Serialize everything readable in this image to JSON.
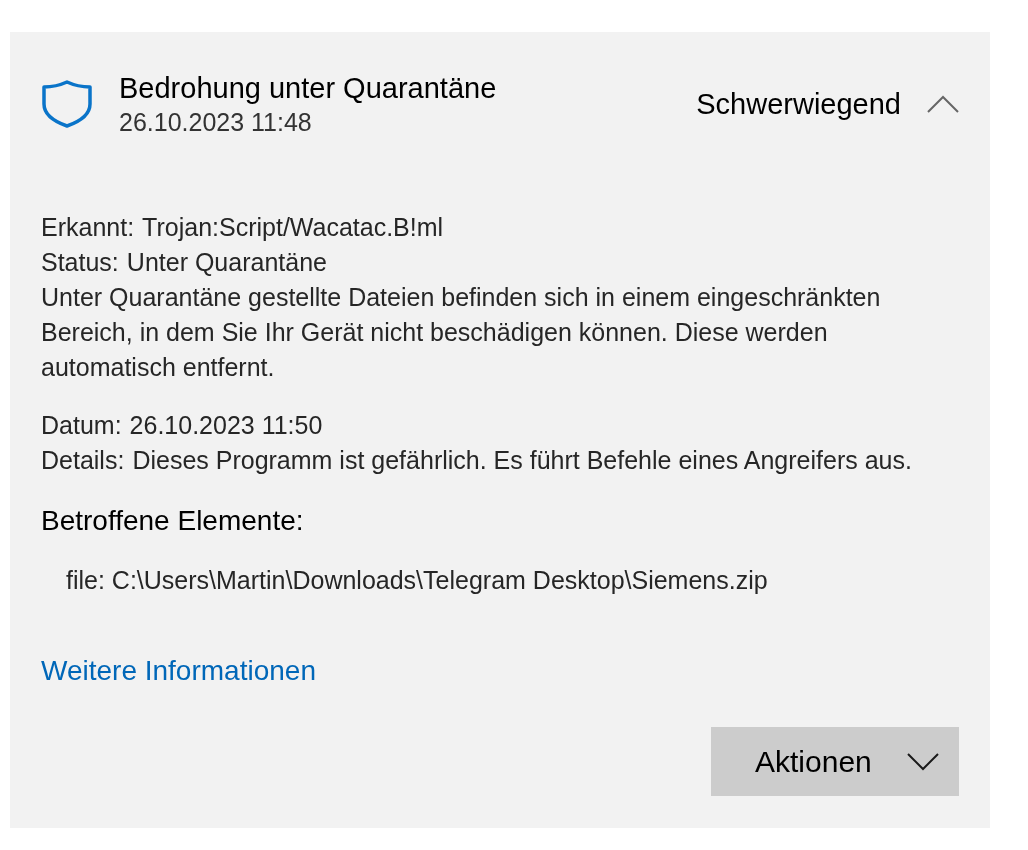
{
  "header": {
    "title": "Bedrohung unter Quarantäne",
    "timestamp": "26.10.2023 11:48",
    "severity": "Schwerwiegend",
    "expanded": true
  },
  "detection": [
    {
      "label": "Erkannt:",
      "value": "Trojan:Script/Wacatac.B!ml"
    },
    {
      "label": "Status:",
      "value": "Unter Quarantäne"
    }
  ],
  "description": "Unter Quarantäne gestellte Dateien befinden sich in einem eingeschränkten Bereich, in dem Sie Ihr Gerät nicht beschädigen können. Diese werden automatisch entfernt.",
  "event": [
    {
      "label": "Datum:",
      "value": "26.10.2023 11:50"
    },
    {
      "label": "Details:",
      "value": "Dieses Programm ist gefährlich. Es führt Befehle eines Angreifers aus."
    }
  ],
  "affected": {
    "heading": "Betroffene Elemente:",
    "items": [
      "file: C:\\Users\\Martin\\Downloads\\Telegram Desktop\\Siemens.zip"
    ]
  },
  "more_info_link": "Weitere Informationen",
  "actions_button": {
    "label": "Aktionen"
  }
}
